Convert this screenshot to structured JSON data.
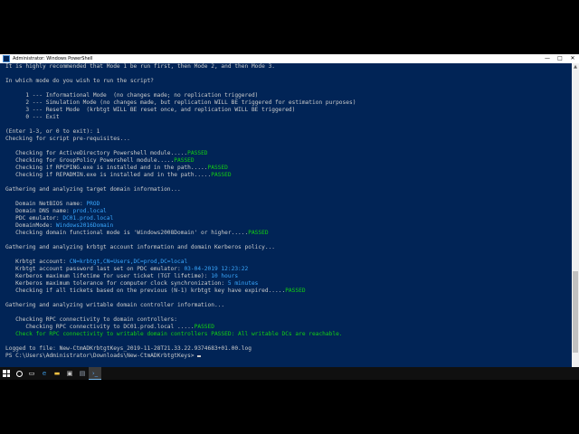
{
  "window": {
    "title": "Administrator: Windows PowerShell",
    "controls": {
      "minimize": "—",
      "maximize": "□",
      "close": "✕"
    }
  },
  "console": {
    "lines": [
      [
        {
          "t": "It is highly recommended that Mode 1 be run first, then Mode 2, and then Mode 3."
        }
      ],
      [
        {
          "t": ""
        }
      ],
      [
        {
          "t": "In which mode do you wish to run the script?"
        }
      ],
      [
        {
          "t": ""
        }
      ],
      [
        {
          "t": "      1 --- Informational Mode  (no changes made; no replication triggered)"
        }
      ],
      [
        {
          "t": "      2 --- Simulation Mode (no changes made, but replication WILL BE triggered for estimation purposes)"
        }
      ],
      [
        {
          "t": "      3 --- Reset Mode  (krbtgt WILL BE reset once, and replication WILL BE triggered)"
        }
      ],
      [
        {
          "t": "      0 --- Exit"
        }
      ],
      [
        {
          "t": ""
        }
      ],
      [
        {
          "t": "(Enter 1-3, or 0 to exit): 1"
        }
      ],
      [
        {
          "t": "Checking for script pre-requisites..."
        }
      ],
      [
        {
          "t": ""
        }
      ],
      [
        {
          "t": "   Checking for ActiveDirectory Powershell module.....",
          "c": ""
        },
        {
          "t": "PASSED",
          "c": "green"
        }
      ],
      [
        {
          "t": "   Checking for GroupPolicy Powershell module.....",
          "c": ""
        },
        {
          "t": "PASSED",
          "c": "green"
        }
      ],
      [
        {
          "t": "   Checking if RPCPING.exe is installed and in the path.....",
          "c": ""
        },
        {
          "t": "PASSED",
          "c": "green"
        }
      ],
      [
        {
          "t": "   Checking if REPADMIN.exe is installed and in the path.....",
          "c": ""
        },
        {
          "t": "PASSED",
          "c": "green"
        }
      ],
      [
        {
          "t": ""
        }
      ],
      [
        {
          "t": "Gathering and analyzing target domain information..."
        }
      ],
      [
        {
          "t": ""
        }
      ],
      [
        {
          "t": "   Domain NetBIOS name: ",
          "c": ""
        },
        {
          "t": "PROD",
          "c": "cyan"
        }
      ],
      [
        {
          "t": "   Domain DNS name: ",
          "c": ""
        },
        {
          "t": "prod.local",
          "c": "cyan"
        }
      ],
      [
        {
          "t": "   PDC emulator: ",
          "c": ""
        },
        {
          "t": "DC01.prod.local",
          "c": "cyan"
        }
      ],
      [
        {
          "t": "   DomainMode: ",
          "c": ""
        },
        {
          "t": "Windows2016Domain",
          "c": "cyan"
        }
      ],
      [
        {
          "t": "   Checking domain functional mode is 'Windows2008Domain' or higher.....",
          "c": ""
        },
        {
          "t": "PASSED",
          "c": "green"
        }
      ],
      [
        {
          "t": ""
        }
      ],
      [
        {
          "t": "Gathering and analyzing krbtgt account information and domain Kerberos policy..."
        }
      ],
      [
        {
          "t": ""
        }
      ],
      [
        {
          "t": "   Krbtgt account: ",
          "c": ""
        },
        {
          "t": "CN=krbtgt,CN=Users,DC=prod,DC=local",
          "c": "cyan"
        }
      ],
      [
        {
          "t": "   Krbtgt account password last set on PDC emulator: ",
          "c": ""
        },
        {
          "t": "03-04-2019 12:23:22",
          "c": "cyan"
        }
      ],
      [
        {
          "t": "   Kerberos maximum lifetime for user ticket (TGT lifetime): ",
          "c": ""
        },
        {
          "t": "10 hours",
          "c": "cyan"
        }
      ],
      [
        {
          "t": "   Kerberos maximum tolerance for computer clock synchronization: ",
          "c": ""
        },
        {
          "t": "5 minutes",
          "c": "cyan"
        }
      ],
      [
        {
          "t": "   Checking if all tickets based on the previous (N-1) krbtgt key have expired.....",
          "c": ""
        },
        {
          "t": "PASSED",
          "c": "green"
        }
      ],
      [
        {
          "t": ""
        }
      ],
      [
        {
          "t": "Gathering and analyzing writable domain controller information..."
        }
      ],
      [
        {
          "t": ""
        }
      ],
      [
        {
          "t": "   Checking RPC connectivity to domain controllers:"
        }
      ],
      [
        {
          "t": "      Checking RPC connectivity to DC01.prod.local .....",
          "c": ""
        },
        {
          "t": "PASSED",
          "c": "green"
        }
      ],
      [
        {
          "t": "   Check for RPC connectivity to writable domain controllers PASSED: All writable DCs are reachable.",
          "c": "green"
        }
      ],
      [
        {
          "t": ""
        }
      ],
      [
        {
          "t": "Logged to file: New-CtmADKrbtgtKeys_2019-11-28T21.33.22.9374683+01.00.log"
        }
      ],
      [
        {
          "t": "PS C:\\Users\\Administrator\\Downloads\\New-CtmADKrbtgtKeys> "
        }
      ]
    ]
  },
  "taskbar": {
    "icons": [
      "windows-start-icon",
      "search-icon",
      "task-view-icon",
      "edge-icon",
      "file-explorer-icon",
      "store-icon",
      "server-manager-icon",
      "powershell-icon",
      "cmd-icon"
    ]
  }
}
